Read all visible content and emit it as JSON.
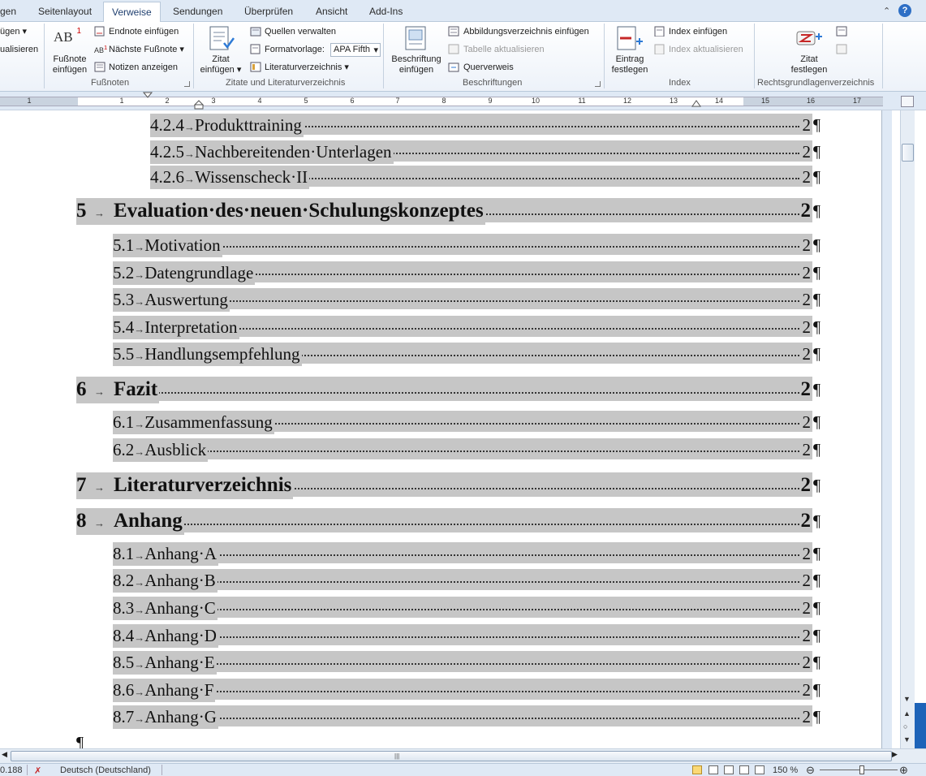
{
  "tabs": [
    {
      "label": "gen",
      "active": false
    },
    {
      "label": "Seitenlayout",
      "active": false
    },
    {
      "label": "Verweise",
      "active": true
    },
    {
      "label": "Sendungen",
      "active": false
    },
    {
      "label": "Überprüfen",
      "active": false
    },
    {
      "label": "Ansicht",
      "active": false
    },
    {
      "label": "Add-Ins",
      "active": false
    }
  ],
  "ribbon": {
    "cut_left_1": "ügen",
    "cut_left_2": "ualisieren",
    "fussnote_label_1": "Fußnote",
    "fussnote_label_2": "einfügen",
    "endnote": "Endnote einfügen",
    "naechste": "Nächste Fußnote",
    "notizen": "Notizen anzeigen",
    "grp_fussnoten": "Fußnoten",
    "zitat_1": "Zitat",
    "zitat_2": "einfügen",
    "quellen": "Quellen verwalten",
    "formatvorlage": "Formatvorlage:",
    "apa": "APA Fifth",
    "literatur": "Literaturverzeichnis",
    "grp_zitate": "Zitate und Literaturverzeichnis",
    "beschriftung_1": "Beschriftung",
    "beschriftung_2": "einfügen",
    "abbildung": "Abbildungsverzeichnis einfügen",
    "tabelle_akt": "Tabelle aktualisieren",
    "querverweis": "Querverweis",
    "grp_beschriftungen": "Beschriftungen",
    "eintrag_1": "Eintrag",
    "eintrag_2": "festlegen",
    "index_einf": "Index einfügen",
    "index_akt": "Index aktualisieren",
    "grp_index": "Index",
    "zitat_fest_1": "Zitat",
    "zitat_fest_2": "festlegen",
    "grp_rechts": "Rechtsgrundlagenverzeichnis"
  },
  "ruler_numbers": [
    "1",
    "1",
    "2",
    "3",
    "4",
    "5",
    "6",
    "7",
    "8",
    "9",
    "10",
    "11",
    "12",
    "13",
    "14",
    "15",
    "16",
    "17"
  ],
  "toc": [
    {
      "num": "4.2.4",
      "title": "Produkttraining",
      "page": "2",
      "level": 3
    },
    {
      "num": "4.2.5",
      "title": "Nachbereitenden·Unterlagen",
      "page": "2",
      "level": 3
    },
    {
      "num": "4.2.6",
      "title": "Wissenscheck·II",
      "page": "2",
      "level": 3
    },
    {
      "num": "5",
      "title": "Evaluation·des·neuen·Schulungskonzeptes",
      "page": "2",
      "level": 1
    },
    {
      "num": "5.1",
      "title": "Motivation",
      "page": "2",
      "level": 2
    },
    {
      "num": "5.2",
      "title": "Datengrundlage",
      "page": "2",
      "level": 2
    },
    {
      "num": "5.3",
      "title": "Auswertung",
      "page": "2",
      "level": 2
    },
    {
      "num": "5.4",
      "title": "Interpretation",
      "page": "2",
      "level": 2
    },
    {
      "num": "5.5",
      "title": "Handlungsempfehlung",
      "page": "2",
      "level": 2
    },
    {
      "num": "6",
      "title": "Fazit",
      "page": "2",
      "level": 1
    },
    {
      "num": "6.1",
      "title": "Zusammenfassung",
      "page": "2",
      "level": 2
    },
    {
      "num": "6.2",
      "title": "Ausblick",
      "page": "2",
      "level": 2
    },
    {
      "num": "7",
      "title": "Literaturverzeichnis",
      "page": "2",
      "level": 1
    },
    {
      "num": "8",
      "title": "Anhang",
      "page": "2",
      "level": 1
    },
    {
      "num": "8.1",
      "title": "Anhang·A",
      "page": "2",
      "level": 2
    },
    {
      "num": "8.2",
      "title": "Anhang·B",
      "page": "2",
      "level": 2
    },
    {
      "num": "8.3",
      "title": "Anhang·C",
      "page": "2",
      "level": 2
    },
    {
      "num": "8.4",
      "title": "Anhang·D",
      "page": "2",
      "level": 2
    },
    {
      "num": "8.5",
      "title": "Anhang·E",
      "page": "2",
      "level": 2
    },
    {
      "num": "8.6",
      "title": "Anhang·F",
      "page": "2",
      "level": 2
    },
    {
      "num": "8.7",
      "title": "Anhang·G",
      "page": "2",
      "level": 2
    }
  ],
  "pilcrow": "¶",
  "status": {
    "words": "0.188",
    "language": "Deutsch (Deutschland)",
    "zoom": "150 %"
  }
}
